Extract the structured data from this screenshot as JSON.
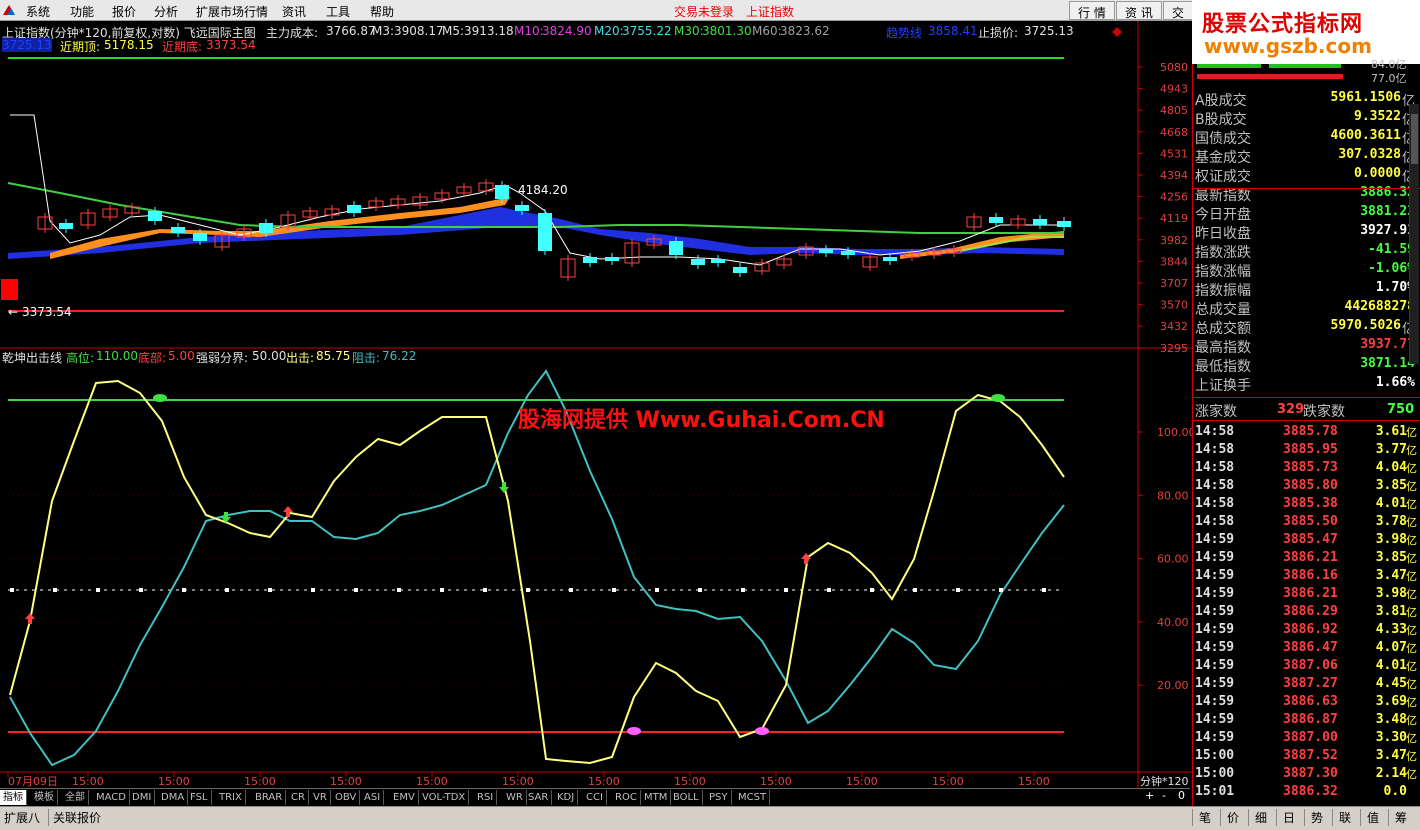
{
  "menu": {
    "items": [
      "系统",
      "功能",
      "报价",
      "分析",
      "扩展市场行情",
      "资讯",
      "工具",
      "帮助"
    ],
    "status_login": "交易未登录",
    "status_index": "上证指数",
    "tabs": [
      "行 情",
      "资 讯",
      "交"
    ]
  },
  "brand": {
    "line1": "股票公式指标网",
    "line2": "www.gszb.com"
  },
  "main_chart": {
    "title": "上证指数(分钟*120,前复权,对数) 飞远国际主图",
    "main_cost_label": "主力成本:",
    "main_cost": "3766.87",
    "m3_label": "M3:",
    "m3": "3908.17",
    "m5_label": "M5:",
    "m5": "3913.18",
    "m10_label": "M10:",
    "m10": "3824.90",
    "m20_label": "M20:",
    "m20": "3755.22",
    "m30_label": "M30:",
    "m30": "3801.30",
    "m60_label": "M60:",
    "m60": "3823.62",
    "support_label": "趋势线",
    "support": "3858.41",
    "stop_label": "止损价:",
    "stop": "3725.13",
    "line2_val": "3725.13",
    "near_top_label": "近期顶:",
    "near_top": "5178.15",
    "near_bottom_label": "近期底:",
    "near_bottom": "3373.54",
    "high_annotation": "4184.20",
    "low_annotation": "3373.54",
    "y_ticks": [
      "5080",
      "4943",
      "4805",
      "4668",
      "4531",
      "4394",
      "4256",
      "4119",
      "3982",
      "3844",
      "3707",
      "3570",
      "3432",
      "3295"
    ]
  },
  "indicator": {
    "name": "乾坤出击线",
    "high_label": "高位:",
    "high": "110.00",
    "bottom_label": "底部:",
    "bottom": "5.00",
    "split_label": "强弱分界:",
    "split": "50.00",
    "attack_label": "出击:",
    "attack": "85.75",
    "resist_label": "阻击:",
    "resist": "76.22",
    "y_ticks": [
      "100.00",
      "80.00",
      "60.00",
      "40.00",
      "20.00"
    ],
    "watermark": "股海网提供 Www.Guhai.Com.CN"
  },
  "x_axis": {
    "labels": [
      "07月09日",
      "15:00",
      "15:00",
      "15:00",
      "15:00",
      "15:00",
      "15:00",
      "15:00",
      "15:00",
      "15:00",
      "15:00",
      "15:00",
      "15:00",
      "15:00"
    ],
    "period": "分钟*120"
  },
  "panel": {
    "top_vals": [
      "84.0亿",
      "77.0亿"
    ],
    "rows": [
      {
        "label": "A股成交",
        "value": "5961.1506",
        "unit": "亿",
        "color": "#ffff40"
      },
      {
        "label": "B股成交",
        "value": "9.3522",
        "unit": "亿",
        "color": "#ffff40"
      },
      {
        "label": "国债成交",
        "value": "4600.3611",
        "unit": "亿",
        "color": "#ffff40"
      },
      {
        "label": "基金成交",
        "value": "307.0328",
        "unit": "亿",
        "color": "#ffff40"
      },
      {
        "label": "权证成交",
        "value": "0.0000",
        "unit": "亿",
        "color": "#ffff40"
      },
      {
        "label": "最新指数",
        "value": "3886.32",
        "unit": "",
        "color": "#40ff40"
      },
      {
        "label": "今日开盘",
        "value": "3881.23",
        "unit": "",
        "color": "#40ff40"
      },
      {
        "label": "昨日收盘",
        "value": "3927.91",
        "unit": "",
        "color": "#ffffff"
      },
      {
        "label": "指数涨跌",
        "value": "-41.59",
        "unit": "",
        "color": "#40ff40"
      },
      {
        "label": "指数涨幅",
        "value": "-1.06%",
        "unit": "",
        "color": "#40ff40"
      },
      {
        "label": "指数振幅",
        "value": "1.70%",
        "unit": "",
        "color": "#ffffff"
      },
      {
        "label": "总成交量",
        "value": "442688278",
        "unit": "",
        "color": "#ffff40"
      },
      {
        "label": "总成交额",
        "value": "5970.5026",
        "unit": "亿",
        "color": "#ffff40"
      },
      {
        "label": "最高指数",
        "value": "3937.77",
        "unit": "",
        "color": "#ff4040"
      },
      {
        "label": "最低指数",
        "value": "3871.14",
        "unit": "",
        "color": "#40ff40"
      },
      {
        "label": "上证换手",
        "value": "1.66%",
        "unit": "",
        "color": "#ffffff"
      }
    ],
    "rise_label": "涨家数",
    "rise": "329",
    "fall_label": "跌家数",
    "fall": "750",
    "ticks": [
      {
        "t": "14:58",
        "p": "3885.78",
        "v": "3.61",
        "u": "亿"
      },
      {
        "t": "14:58",
        "p": "3885.95",
        "v": "3.77",
        "u": "亿"
      },
      {
        "t": "14:58",
        "p": "3885.73",
        "v": "4.04",
        "u": "亿"
      },
      {
        "t": "14:58",
        "p": "3885.80",
        "v": "3.85",
        "u": "亿"
      },
      {
        "t": "14:58",
        "p": "3885.38",
        "v": "4.01",
        "u": "亿"
      },
      {
        "t": "14:58",
        "p": "3885.50",
        "v": "3.78",
        "u": "亿"
      },
      {
        "t": "14:59",
        "p": "3885.47",
        "v": "3.98",
        "u": "亿"
      },
      {
        "t": "14:59",
        "p": "3886.21",
        "v": "3.85",
        "u": "亿"
      },
      {
        "t": "14:59",
        "p": "3886.16",
        "v": "3.47",
        "u": "亿"
      },
      {
        "t": "14:59",
        "p": "3886.21",
        "v": "3.98",
        "u": "亿"
      },
      {
        "t": "14:59",
        "p": "3886.29",
        "v": "3.81",
        "u": "亿"
      },
      {
        "t": "14:59",
        "p": "3886.92",
        "v": "4.33",
        "u": "亿"
      },
      {
        "t": "14:59",
        "p": "3886.47",
        "v": "4.07",
        "u": "亿"
      },
      {
        "t": "14:59",
        "p": "3887.06",
        "v": "4.01",
        "u": "亿"
      },
      {
        "t": "14:59",
        "p": "3887.27",
        "v": "4.45",
        "u": "亿"
      },
      {
        "t": "14:59",
        "p": "3886.63",
        "v": "3.69",
        "u": "亿"
      },
      {
        "t": "14:59",
        "p": "3886.87",
        "v": "3.48",
        "u": "亿"
      },
      {
        "t": "14:59",
        "p": "3887.00",
        "v": "3.30",
        "u": "亿"
      },
      {
        "t": "15:00",
        "p": "3887.52",
        "v": "3.47",
        "u": "亿"
      },
      {
        "t": "15:00",
        "p": "3887.30",
        "v": "2.14",
        "u": "亿"
      },
      {
        "t": "15:01",
        "p": "3886.32",
        "v": "0.0",
        "u": ""
      }
    ]
  },
  "indicator_tabs": [
    "指标",
    "模板",
    "全部",
    "MACD",
    "DMI",
    "DMA",
    "FSL",
    "TRIX",
    "BRAR",
    "CR",
    "VR",
    "OBV",
    "ASI",
    "EMV",
    "VOL-TDX",
    "RSI",
    "WR",
    "SAR",
    "KDJ",
    "CCI",
    "ROC",
    "MTM",
    "BOLL",
    "PSY",
    "MCST"
  ],
  "chart_controls": {
    "plus": "+",
    "minus": "-",
    "zero": "0"
  },
  "bottom_bar": {
    "left": [
      "扩展八",
      "关联报价"
    ],
    "right": [
      "笔",
      "价",
      "细",
      "日",
      "势",
      "联",
      "值",
      "筹"
    ]
  },
  "colors": {
    "up": "#ff4040",
    "down": "#40ffff",
    "high_line": "#40ff40",
    "low_line": "#ff2020",
    "attack": "#ffff80",
    "resist": "#40c0c0"
  }
}
